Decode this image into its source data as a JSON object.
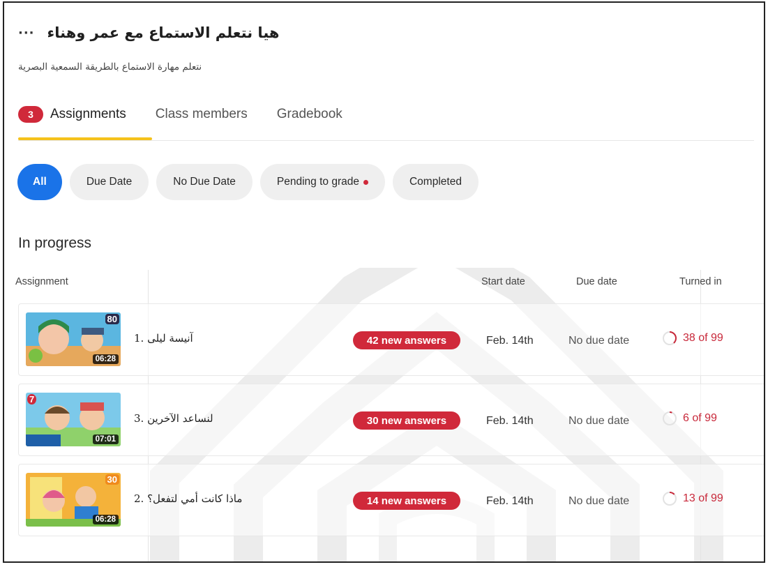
{
  "header": {
    "class_title": "هيا نتعلم الاستماع مع عمر وهناء",
    "more_icon": "more-horizontal-icon",
    "more_symbol": "···",
    "subtitle": "نتعلم مهارة الاستماع بالطريقة السمعية البصرية"
  },
  "tabs": [
    {
      "label": "Assignments",
      "badge": "3",
      "active": true
    },
    {
      "label": "Class members"
    },
    {
      "label": "Gradebook"
    }
  ],
  "filters": [
    {
      "label": "All",
      "active": true
    },
    {
      "label": "Due Date"
    },
    {
      "label": "No Due Date"
    },
    {
      "label": "Pending to grade",
      "has_dot": true
    },
    {
      "label": "Completed"
    }
  ],
  "section": {
    "title": "In progress"
  },
  "columns": {
    "assignment": "Assignment",
    "start_date": "Start date",
    "due_date": "Due date",
    "turned_in": "Turned in"
  },
  "assignments": [
    {
      "title": "1. آنيسة ليلى",
      "duration": "06:28",
      "thumb_badge": "80",
      "new_answers": "42 new answers",
      "start_date": "Feb. 14th",
      "due_date": "No due date",
      "turned_in": "38 of 99",
      "turned_count": 38,
      "total": 99
    },
    {
      "title": "3. لنساعد الآخرين",
      "duration": "07:01",
      "thumb_badge": "7",
      "new_answers": "30 new answers",
      "start_date": "Feb. 14th",
      "due_date": "No due date",
      "turned_in": "6 of 99",
      "turned_count": 6,
      "total": 99
    },
    {
      "title": "2. ماذا كانت أمي لتفعل؟",
      "duration": "06:28",
      "thumb_badge": "30",
      "new_answers": "14 new answers",
      "start_date": "Feb. 14th",
      "due_date": "No due date",
      "turned_in": "13 of 99",
      "turned_count": 13,
      "total": 99
    }
  ],
  "colors": {
    "accent_blue": "#1a73e8",
    "alert_red": "#d0293a",
    "tab_underline": "#f5c21b",
    "progress_ring": "#c8283a"
  }
}
